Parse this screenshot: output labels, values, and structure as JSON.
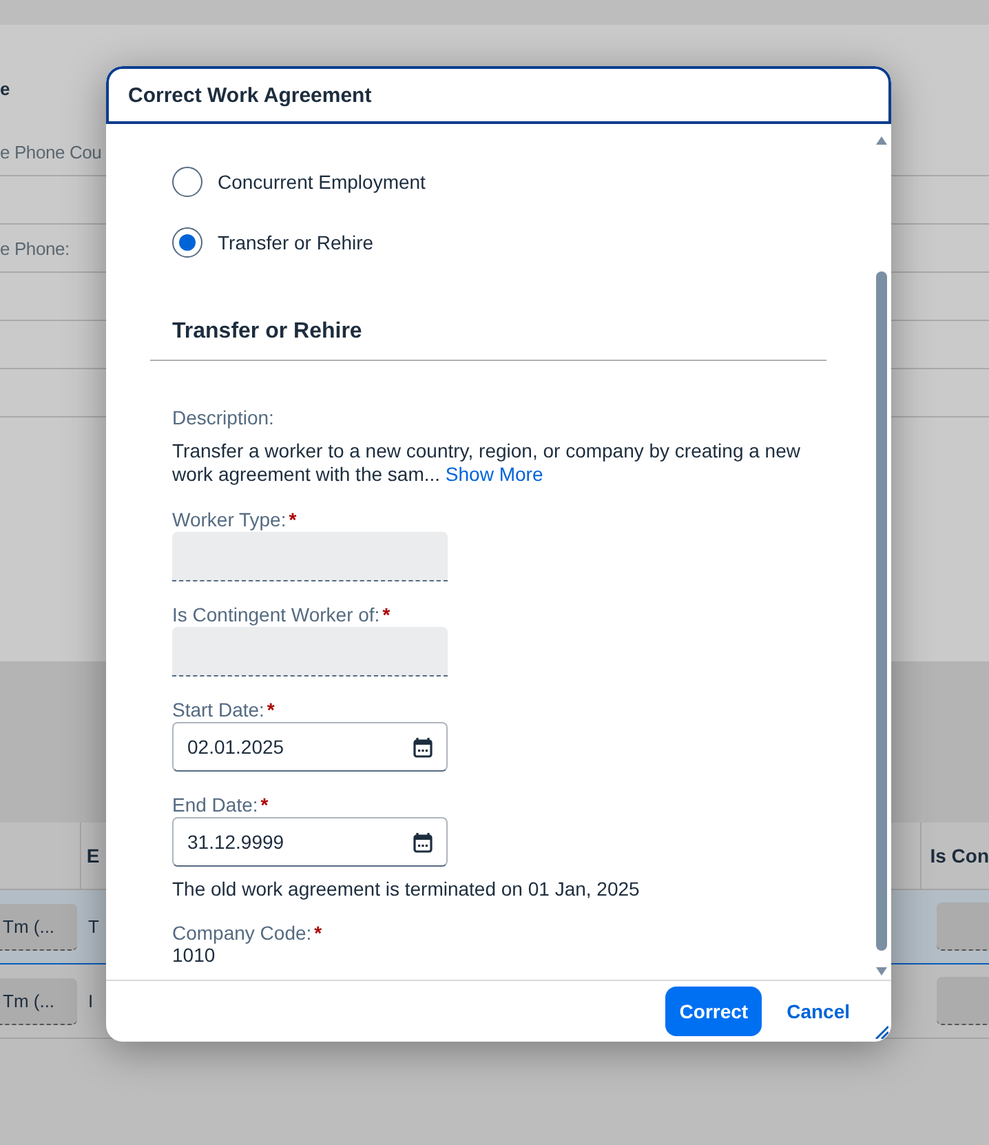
{
  "background": {
    "labels": [
      "e",
      "e Phone Cou",
      "e Phone:"
    ],
    "table": {
      "columns": [
        "",
        "E",
        "Is Con"
      ],
      "rows": [
        {
          "selected": true,
          "cells": [
            "Tm (...",
            "T"
          ]
        },
        {
          "selected": false,
          "cells": [
            "Tm (...",
            "I"
          ]
        }
      ]
    }
  },
  "dialog": {
    "title": "Correct Work Agreement",
    "required_mark": "*",
    "options": [
      {
        "label": "Concurrent Employment",
        "selected": false
      },
      {
        "label": "Transfer or Rehire",
        "selected": true
      }
    ],
    "section_title": "Transfer or Rehire",
    "description": {
      "label": "Description:",
      "text": "Transfer a worker to a new country, region, or company by creating a new work agreement with the sam...",
      "link": "Show More"
    },
    "fields": [
      {
        "kind": "empty",
        "label": "Worker Type:",
        "required": true
      },
      {
        "kind": "empty",
        "label": "Is Contingent Worker of:",
        "required": true
      },
      {
        "kind": "date",
        "label": "Start Date:",
        "required": true,
        "value": "02.01.2025"
      },
      {
        "kind": "date",
        "label": "End Date:",
        "required": true,
        "value": "31.12.9999",
        "note": "The old work agreement is terminated on 01 Jan, 2025"
      },
      {
        "kind": "display",
        "label": "Company Code:",
        "required": true,
        "value": "1010"
      }
    ],
    "buttons": [
      {
        "label": "Correct",
        "kind": "primary"
      },
      {
        "label": "Cancel",
        "kind": "link"
      }
    ]
  }
}
